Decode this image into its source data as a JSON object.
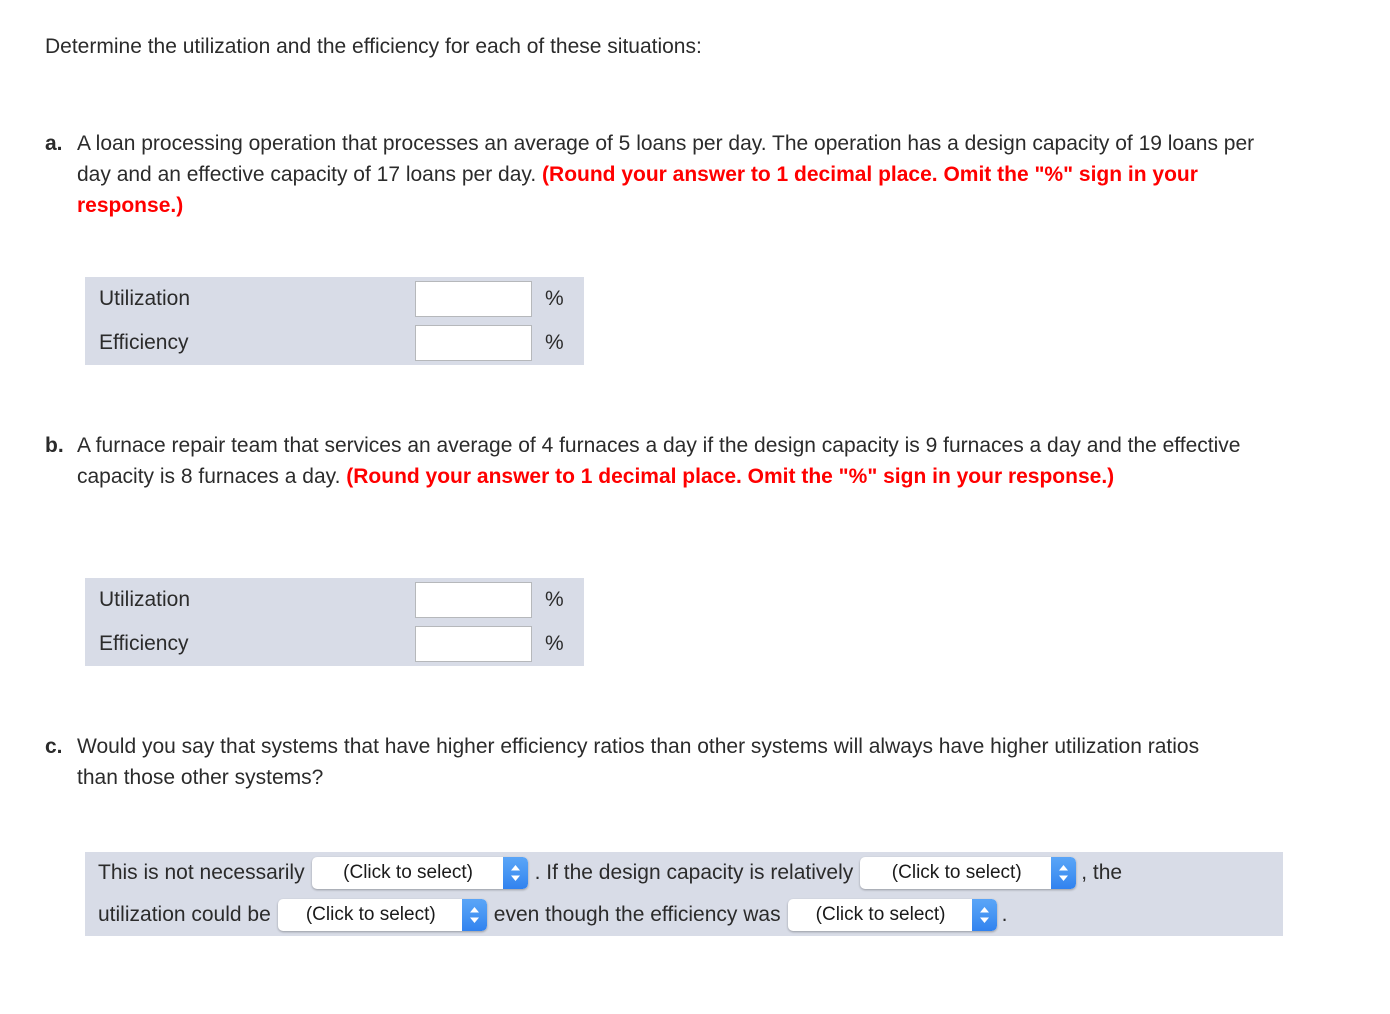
{
  "intro": {
    "text": "Determine the utilization and the efficiency for each of these situations:"
  },
  "questions": [
    {
      "marker": "a.",
      "text": "A loan processing operation that processes an average of 5 loans per day. The operation has a design capacity of 19 loans per day and an effective capacity of 17 loans per day. ",
      "note": "(Round your answer to 1 decimal place. Omit the \"%\" sign in your response.)"
    },
    {
      "marker": "b.",
      "text": "A furnace repair team that services an average of 4 furnaces a day if the design capacity is 9 furnaces a day and the effective capacity is 8 furnaces a day. ",
      "note": "(Round your answer to 1 decimal place. Omit the \"%\" sign in your response.)"
    },
    {
      "marker": "c.",
      "text": "Would you say that systems that have higher efficiency ratios than other systems will always have higher utilization ratios than those other systems?",
      "note": ""
    }
  ],
  "answer_tables": [
    {
      "rows": [
        {
          "label": "Utilization",
          "value": "",
          "unit": "%"
        },
        {
          "label": "Efficiency",
          "value": "",
          "unit": "%"
        }
      ]
    },
    {
      "rows": [
        {
          "label": "Utilization",
          "value": "",
          "unit": "%"
        },
        {
          "label": "Efficiency",
          "value": "",
          "unit": "%"
        }
      ]
    }
  ],
  "statement": {
    "line1": {
      "lead": "This is not necessarily",
      "mid": ". If the design capacity is relatively",
      "tail": ", the"
    },
    "line2": {
      "lead": "utilization could be",
      "mid": "even though the efficiency was",
      "tail": "."
    },
    "dropdowns": [
      {
        "selected": "(Click to select)"
      },
      {
        "selected": "(Click to select)"
      },
      {
        "selected": "(Click to select)"
      },
      {
        "selected": "(Click to select)"
      }
    ]
  },
  "colors": {
    "panel_bg": "#d8dce7",
    "note_red": "#ff0000",
    "text": "#2b2b2b",
    "dropdown_blue": "#4796f3"
  }
}
